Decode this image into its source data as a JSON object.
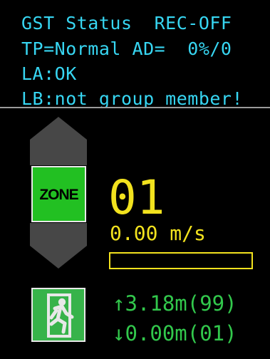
{
  "header": {
    "line1": "GST Status  REC-OFF",
    "line2": "TP=Normal AD=  0%/0",
    "line3": "LA:OK",
    "line4": "LB:not group member!"
  },
  "panel": {
    "zone_label": "ZONE",
    "floor_number": "01",
    "speed": "0.00 m/s",
    "speed_bar_fraction": 0,
    "readout_up": "↑3.18m(99)",
    "readout_down": "↓0.00m(01)"
  },
  "icons": {
    "up_arrow": "up-arrow-icon",
    "down_arrow": "down-arrow-icon",
    "exit": "emergency-exit-icon"
  },
  "colors": {
    "status_text": "#37d6f2",
    "accent_yellow": "#f2e21e",
    "zone_green": "#22c022",
    "readout_green": "#32c84c",
    "arrow_gray": "#474747"
  }
}
